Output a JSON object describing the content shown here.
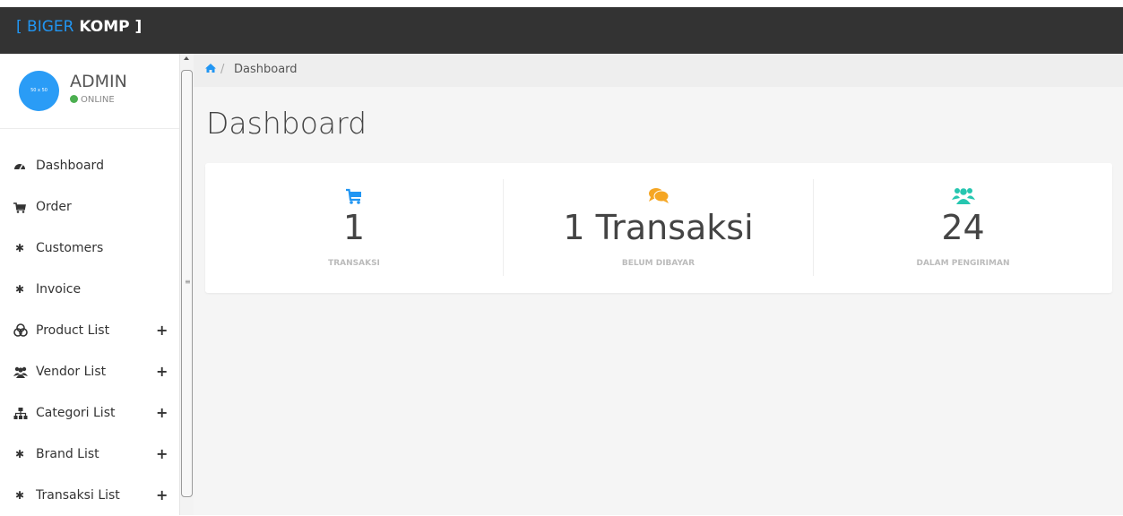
{
  "header": {
    "brand_open": "[ ",
    "brand_first": "BIGER",
    "brand_second": " KOMP ]",
    "bar_color": "#333333",
    "accent_color": "#2196f3"
  },
  "profile": {
    "avatar_text": "50 x 50",
    "name": "ADMIN",
    "status": "ONLINE",
    "status_color": "#4caf50"
  },
  "menu": {
    "items": [
      {
        "label": "Dashboard",
        "icon": "tachometer-icon",
        "expandable": false
      },
      {
        "label": "Order",
        "icon": "cart-icon",
        "expandable": false
      },
      {
        "label": "Customers",
        "icon": "asterisk-icon",
        "expandable": false
      },
      {
        "label": "Invoice",
        "icon": "asterisk-icon",
        "expandable": false
      },
      {
        "label": "Product List",
        "icon": "cubes-icon",
        "expandable": true
      },
      {
        "label": "Vendor List",
        "icon": "users-icon",
        "expandable": true
      },
      {
        "label": "Categori List",
        "icon": "sitemap-icon",
        "expandable": true
      },
      {
        "label": "Brand List",
        "icon": "asterisk-icon",
        "expandable": true
      },
      {
        "label": "Transaksi List",
        "icon": "asterisk-icon",
        "expandable": true
      }
    ],
    "expand_symbol": "+"
  },
  "breadcrumb": {
    "home_icon": "home-icon",
    "separator": "/",
    "current": "Dashboard"
  },
  "page": {
    "title": "Dashboard"
  },
  "stats": [
    {
      "icon": "cart-icon",
      "icon_color": "#2196f3",
      "value": "1",
      "label": "TRANSAKSI"
    },
    {
      "icon": "comments-icon",
      "icon_color": "#f5a623",
      "value": "1 Transaksi",
      "label": "BELUM DIBAYAR"
    },
    {
      "icon": "users-icon",
      "icon_color": "#26c6b0",
      "value": "24",
      "label": "DALAM PENGIRIMAN"
    }
  ]
}
